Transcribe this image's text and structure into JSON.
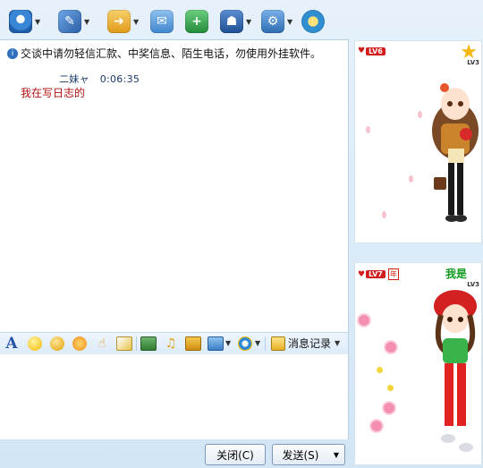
{
  "toolbar": {
    "items": [
      {
        "icon": "webcam-icon",
        "color": "#3a86d6",
        "has_menu": true
      },
      {
        "icon": "microphone-icon",
        "color": "#3c78c8",
        "has_menu": true
      },
      {
        "icon": "send-file-icon",
        "color": "#e7a320",
        "has_menu": true
      },
      {
        "icon": "email-icon",
        "color": "#4a8fd0",
        "has_menu": false
      },
      {
        "icon": "create-group-icon",
        "color": "#2f9a46",
        "has_menu": false
      },
      {
        "icon": "app-icon",
        "color": "#2d5a9e",
        "has_menu": true
      },
      {
        "icon": "settings-icon",
        "color": "#2f7ac0",
        "has_menu": true
      },
      {
        "icon": "remote-icon",
        "color": "#2f8fd0",
        "has_menu": false
      }
    ]
  },
  "chat": {
    "notice": "交谈中请勿轻信汇款、中奖信息、陌生电话，勿使用外挂软件。",
    "messages": [
      {
        "sender": "二妹ャ",
        "time": "0:06:35",
        "text": "我在写日志的"
      }
    ]
  },
  "format_bar": {
    "history_label": "消息记录"
  },
  "buttons": {
    "close_label": "关闭(C)",
    "send_label": "发送(S)"
  },
  "avatars": {
    "top": {
      "level_badge": "LV6",
      "star_level": "LV3"
    },
    "bottom": {
      "level_badge": "LV7",
      "year_badge": "年",
      "name": "我是",
      "star_level": "LV3"
    }
  },
  "colors": {
    "message_text": "#b01010",
    "sender_header": "#1a3a6a",
    "panel_bg": "#d2e6f6",
    "level_badge": "#d21d1d"
  }
}
